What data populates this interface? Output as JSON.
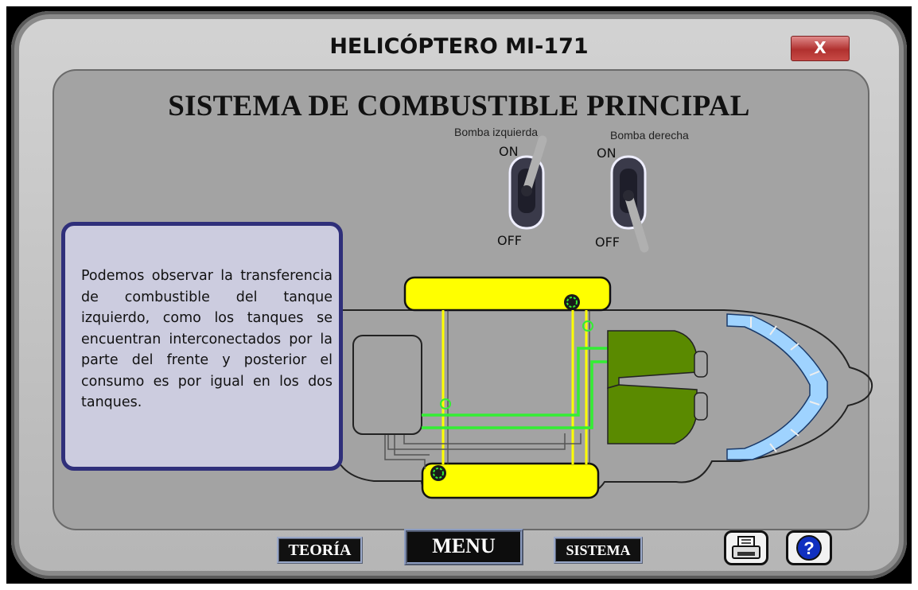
{
  "window": {
    "title": "HELICÓPTERO MI-171",
    "close_label": "X"
  },
  "heading": "SISTEMA DE COMBUSTIBLE PRINCIPAL",
  "switches": {
    "left": {
      "label": "Bomba izquierda",
      "on": "ON",
      "off": "OFF",
      "state": "ON"
    },
    "right": {
      "label": "Bomba derecha",
      "on": "ON",
      "off": "OFF",
      "state": "OFF"
    }
  },
  "info": {
    "text": "Podemos observar la transferencia de combustible del tanque izquierdo, como los tanques se encuentran interconectados por la parte del frente y posterior el consumo es por igual en los dos tanques."
  },
  "footer": {
    "teoria": "TEORÍA",
    "menu": "MENU",
    "sistema": "SISTEMA"
  },
  "icons": {
    "print": "printer-icon",
    "help": "help-icon"
  },
  "colors": {
    "tank": "#ffff00",
    "fuel_line": "#33ee33",
    "engine": "#5a8a00",
    "window": "#9fd3ff",
    "panel": "#a3a3a3",
    "info_border": "#2f2f7a",
    "close": "#b0302e"
  }
}
